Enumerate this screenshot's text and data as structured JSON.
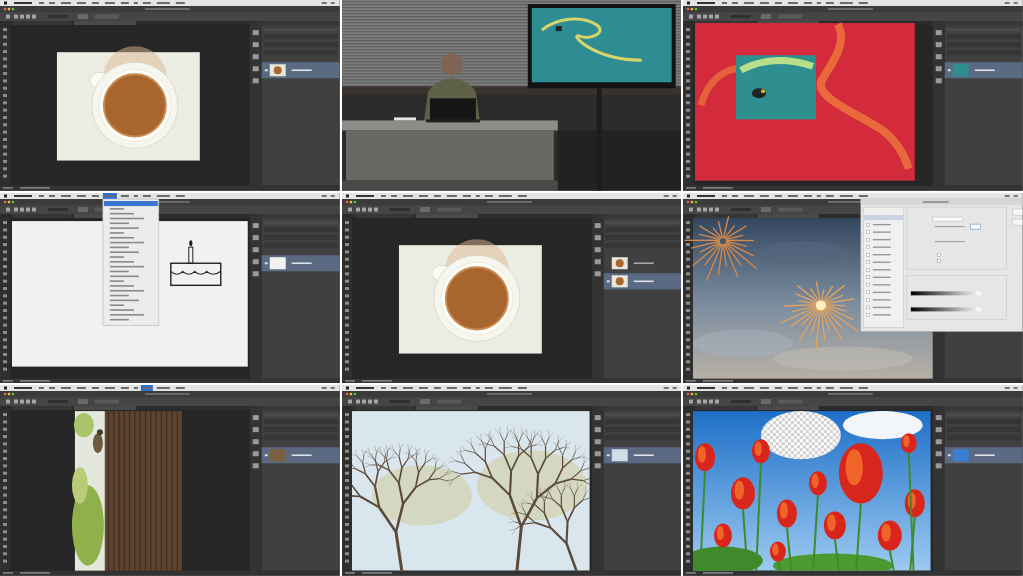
{
  "frames": [
    {
      "kind": "coffee"
    },
    {
      "kind": "studio"
    },
    {
      "kind": "smoke"
    },
    {
      "kind": "sketch"
    },
    {
      "kind": "duplicate"
    },
    {
      "kind": "fireworks"
    },
    {
      "kind": "woodpecker"
    },
    {
      "kind": "branches"
    },
    {
      "kind": "tulips"
    }
  ]
}
